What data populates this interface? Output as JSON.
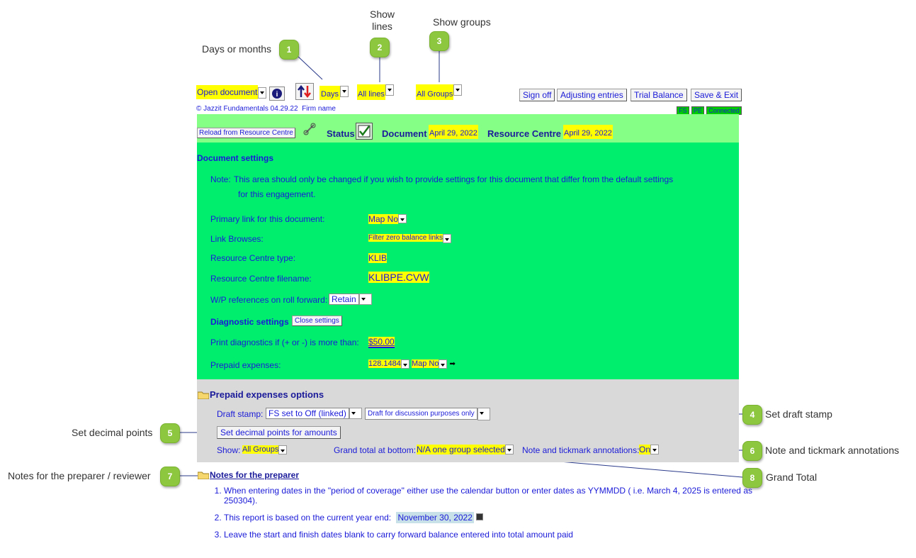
{
  "annotations": {
    "days_or_months": "Days or months",
    "show_lines": "Show\nlines",
    "show_groups": "Show groups",
    "set_draft_stamp": "Set draft stamp",
    "set_decimal_points": "Set decimal points",
    "note_tickmark": "Note and tickmark annotations",
    "notes_preparer_reviewer": "Notes for the preparer / reviewer",
    "grand_total": "Grand Total",
    "bubbles": [
      "1",
      "2",
      "3",
      "4",
      "5",
      "6",
      "7",
      "8"
    ]
  },
  "toolbar": {
    "open_document": "Open document",
    "days": "Days",
    "all_lines": "All lines",
    "all_groups": "All Groups",
    "sign_off": "Sign off",
    "adjusting_entries": "Adjusting entries",
    "trial_balance": "Trial Balance",
    "save_exit": "Save & Exit",
    "copyright": "© Jazzit Fundamentals 04.29.22  Firm name",
    "fs": "FS",
    "pe": "PE",
    "connected": "Connected"
  },
  "status_bar": {
    "reload": "Reload from Resource Centre",
    "status_label": "Status:",
    "document_label": "Document :",
    "document_date": "April 29, 2022",
    "rc_label": "Resource Centre :",
    "rc_date": "April 29, 2022"
  },
  "settings": {
    "title": "Document settings",
    "note_label": "Note:",
    "note_line1": "This area should only be changed if you wish to provide settings for this document that differ from the default settings",
    "note_line2": "for this engagement.",
    "primary_link_label": "Primary link for this document:",
    "primary_link_value": "Map No",
    "link_browses_label": "Link Browses:",
    "link_browses_value": "Filter zero balance links",
    "rc_type_label": "Resource Centre type:",
    "rc_type_value": "KLIB",
    "rc_filename_label": "Resource Centre filename:",
    "rc_filename_value": "KLIBPE.CVW",
    "wp_label": "W/P references on roll forward:",
    "wp_value": "Retain",
    "diag_label": "Diagnostic settings",
    "close_settings": "Close settings",
    "print_diag_label": "Print diagnostics if (+ or -) is more than:",
    "print_diag_value": "$50.00",
    "prepaid_label": "Prepaid expenses:",
    "prepaid_value1": "128.1484",
    "prepaid_value2": "Map No"
  },
  "options": {
    "title": "Prepaid expenses options",
    "draft_stamp_label": "Draft stamp:",
    "draft_stamp_value": "FS set to Off (linked)",
    "draft_text": "Draft for discussion purposes only",
    "decimal_button": "Set decimal points for amounts",
    "show_label": "Show:",
    "show_value": "All Groups",
    "grand_total_label": "Grand total at bottom:",
    "grand_total_value": "N/A one group selected",
    "note_tick_label": "Note and tickmark annotations:",
    "note_tick_value": "On"
  },
  "notes": {
    "title": "Notes for the preparer",
    "item1": "When entering dates in the \"period of coverage\" either use the calendar button or enter dates as YYMMDD ( i.e. March 4, 2025 is entered as 250304).",
    "item2_text": "This report is based on the current year end:",
    "item2_date": "November 30, 2022",
    "item3": "Leave the start and finish dates blank to carry forward balance entered into total amount paid"
  }
}
